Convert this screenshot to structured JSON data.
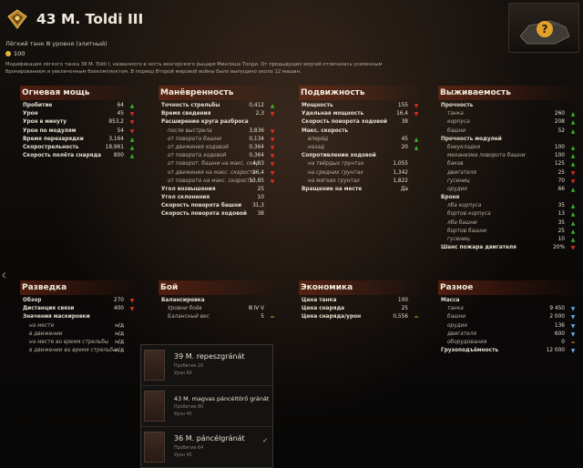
{
  "header": {
    "title": "43 M. Toldi III",
    "subtitle": "Лёгкий танк Ⅲ уровня (элитный)",
    "price": "100",
    "description": "Модификация лёгкого танка 38 M. Toldi I, названного в честь венгерского рыцаря Миклоша Толди. От предыдущих версий отличалась усиленным бронированием и увеличенным боекомплектом. В период Второй мировой войны было выпущено около 12 машин."
  },
  "colors": {
    "up": "#38b02a",
    "down": "#d63020",
    "equal": "#e1a02a",
    "blue": "#6aa2e0",
    "coin": "#e2b43a"
  },
  "panels": {
    "firepower": {
      "title": "Огневая мощь",
      "rows": [
        {
          "label": "Пробитие",
          "value": "64",
          "ind": "up",
          "cls": "up"
        },
        {
          "label": "Урон",
          "value": "45",
          "ind": "down",
          "cls": "down"
        },
        {
          "label": "Урон в минуту",
          "value": "853,2",
          "ind": "down",
          "cls": "down"
        },
        {
          "label": "Урон по модулям",
          "value": "54",
          "ind": "down",
          "cls": "down"
        },
        {
          "label": "Время перезарядки",
          "value": "3,164",
          "ind": "up",
          "cls": "up"
        },
        {
          "label": "Скорострельность",
          "value": "18,961",
          "ind": "up",
          "cls": "up"
        },
        {
          "label": "Скорость полёта снаряда",
          "value": "800",
          "ind": "up",
          "cls": "up"
        }
      ]
    },
    "maneuver": {
      "title": "Манёвренность",
      "rows": [
        {
          "label": "Точность стрельбы",
          "value": "0,412",
          "ind": "up",
          "cls": "up"
        },
        {
          "label": "Время сведения",
          "value": "2,3",
          "ind": "down",
          "cls": "down"
        },
        {
          "label": "Расширение круга разброса",
          "value": "",
          "ind": "",
          "cls": ""
        },
        {
          "label": "после выстрела",
          "value": "3,836",
          "ind": "down",
          "cls": "down",
          "sub": true
        },
        {
          "label": "от поворота башни",
          "value": "0,134",
          "ind": "down",
          "cls": "down",
          "sub": true
        },
        {
          "label": "от движения ходовой",
          "value": "0,364",
          "ind": "down",
          "cls": "down",
          "sub": true
        },
        {
          "label": "от поворота ходовой",
          "value": "0,364",
          "ind": "down",
          "cls": "down",
          "sub": true
        },
        {
          "label": "от поворот. башни на макс. скор.",
          "value": "4,03",
          "ind": "down",
          "cls": "down",
          "sub": true
        },
        {
          "label": "от движения на макс. скорости",
          "value": "16,4",
          "ind": "down",
          "cls": "down",
          "sub": true
        },
        {
          "label": "от поворота на макс. скорости",
          "value": "13,85",
          "ind": "down",
          "cls": "down",
          "sub": true
        },
        {
          "label": "Угол возвышения",
          "value": "25",
          "ind": "",
          "cls": ""
        },
        {
          "label": "Угол склонения",
          "value": "10",
          "ind": "",
          "cls": ""
        },
        {
          "label": "Скорость поворота башни",
          "value": "31,3",
          "ind": "",
          "cls": ""
        },
        {
          "label": "Скорость поворота ходовой",
          "value": "38",
          "ind": "",
          "cls": ""
        }
      ]
    },
    "mobility": {
      "title": "Подвижность",
      "rows": [
        {
          "label": "Мощность",
          "value": "155",
          "ind": "down",
          "cls": "down"
        },
        {
          "label": "Удельная мощность",
          "value": "16,4",
          "ind": "down",
          "cls": "down"
        },
        {
          "label": "Скорость поворота ходовой",
          "value": "38",
          "ind": "",
          "cls": ""
        },
        {
          "label": "Макс. скорость",
          "value": "",
          "ind": "",
          "cls": ""
        },
        {
          "label": "вперёд",
          "value": "45",
          "ind": "up",
          "cls": "up",
          "sub": true
        },
        {
          "label": "назад",
          "value": "20",
          "ind": "up",
          "cls": "up",
          "sub": true
        },
        {
          "label": "Сопротивление ходовой",
          "value": "",
          "ind": "",
          "cls": ""
        },
        {
          "label": "на твёрдых грунтах",
          "value": "1,055",
          "ind": "",
          "cls": "",
          "sub": true
        },
        {
          "label": "на средних грунтах",
          "value": "1,342",
          "ind": "",
          "cls": "",
          "sub": true
        },
        {
          "label": "на мягких грунтах",
          "value": "1,822",
          "ind": "",
          "cls": "",
          "sub": true
        },
        {
          "label": "Вращение на месте",
          "value": "Да",
          "ind": "",
          "cls": ""
        }
      ]
    },
    "survivability": {
      "title": "Выживаемость",
      "rows": [
        {
          "label": "Прочность",
          "value": "",
          "ind": "",
          "cls": ""
        },
        {
          "label": "танка",
          "value": "260",
          "ind": "up",
          "cls": "up",
          "sub": true
        },
        {
          "label": "корпуса",
          "value": "208",
          "ind": "up",
          "cls": "up",
          "sub": true
        },
        {
          "label": "башни",
          "value": "52",
          "ind": "up",
          "cls": "up",
          "sub": true
        },
        {
          "label": "Прочность модулей",
          "value": "",
          "ind": "",
          "cls": ""
        },
        {
          "label": "боеукладки",
          "value": "100",
          "ind": "up",
          "cls": "up",
          "sub": true
        },
        {
          "label": "механизма поворота башни",
          "value": "100",
          "ind": "up",
          "cls": "up",
          "sub": true
        },
        {
          "label": "баков",
          "value": "125",
          "ind": "up",
          "cls": "up",
          "sub": true
        },
        {
          "label": "двигателя",
          "value": "25",
          "ind": "down",
          "cls": "down",
          "sub": true
        },
        {
          "label": "гусениц",
          "value": "70",
          "ind": "down",
          "cls": "down",
          "sub": true
        },
        {
          "label": "орудия",
          "value": "66",
          "ind": "up",
          "cls": "up",
          "sub": true
        },
        {
          "label": "Броня",
          "value": "",
          "ind": "",
          "cls": ""
        },
        {
          "label": "лба корпуса",
          "value": "35",
          "ind": "up",
          "cls": "up",
          "sub": true
        },
        {
          "label": "бортов корпуса",
          "value": "13",
          "ind": "up",
          "cls": "up",
          "sub": true
        },
        {
          "label": "лба башни",
          "value": "35",
          "ind": "up",
          "cls": "up",
          "sub": true
        },
        {
          "label": "бортов башни",
          "value": "25",
          "ind": "up",
          "cls": "up",
          "sub": true
        },
        {
          "label": "гусениц",
          "value": "10",
          "ind": "up",
          "cls": "up",
          "sub": true
        },
        {
          "label": "Шанс пожара двигателя",
          "value": "20%",
          "ind": "down",
          "cls": "down"
        }
      ]
    },
    "recon": {
      "title": "Разведка",
      "rows": [
        {
          "label": "Обзор",
          "value": "270",
          "ind": "down",
          "cls": "down"
        },
        {
          "label": "Дистанция связи",
          "value": "400",
          "ind": "down",
          "cls": "down"
        },
        {
          "label": "Значения маскировки",
          "value": "",
          "ind": "",
          "cls": ""
        },
        {
          "label": "на месте",
          "value": "н/д",
          "ind": "",
          "cls": "",
          "sub": true
        },
        {
          "label": "в движении",
          "value": "н/д",
          "ind": "",
          "cls": "",
          "sub": true
        },
        {
          "label": "на месте во время стрельбы",
          "value": "н/д",
          "ind": "",
          "cls": "",
          "sub": true
        },
        {
          "label": "в движении во время стрельбы",
          "value": "н/д",
          "ind": "",
          "cls": "",
          "sub": true
        }
      ]
    },
    "battle": {
      "title": "Бой",
      "rows": [
        {
          "label": "Балансировка",
          "value": "",
          "ind": "",
          "cls": ""
        },
        {
          "label": "Уровни боёв",
          "value": "Ⅲ Ⅳ V",
          "ind": "",
          "cls": "",
          "sub": true
        },
        {
          "label": "Балансный вес",
          "value": "5",
          "ind": "eq",
          "cls": "eq",
          "sub": true
        }
      ]
    },
    "economy": {
      "title": "Экономика",
      "rows": [
        {
          "label": "Цена танка",
          "value": "100",
          "ind": "",
          "cls": ""
        },
        {
          "label": "Цена снаряда",
          "value": "25",
          "ind": "",
          "cls": ""
        },
        {
          "label": "Цена снаряда/урон",
          "value": "0,556",
          "ind": "eq",
          "cls": "eq"
        }
      ]
    },
    "misc": {
      "title": "Разное",
      "rows": [
        {
          "label": "Масса",
          "value": "",
          "ind": "",
          "cls": ""
        },
        {
          "label": "танка",
          "value": "9 450",
          "ind": "blue",
          "cls": "blue",
          "sub": true
        },
        {
          "label": "башни",
          "value": "2 000",
          "ind": "blue",
          "cls": "blue",
          "sub": true
        },
        {
          "label": "орудия",
          "value": "136",
          "ind": "blue",
          "cls": "blue",
          "sub": true
        },
        {
          "label": "двигателя",
          "value": "600",
          "ind": "blue",
          "cls": "blue",
          "sub": true
        },
        {
          "label": "оборудования",
          "value": "0",
          "ind": "eq",
          "cls": "eq",
          "sub": true
        },
        {
          "label": "Грузоподъёмность",
          "value": "12 000",
          "ind": "blue",
          "cls": "blue"
        }
      ]
    }
  },
  "ammo": [
    {
      "name": "39 M. repeszgránát",
      "pen": "Пробитие 20",
      "dmg": "Урон 60",
      "selected": ""
    },
    {
      "name": "43 M. magvas páncéltörő gránát",
      "pen": "Пробитие 80",
      "dmg": "Урон 45",
      "selected": ""
    },
    {
      "name": "36 M. páncélgránát",
      "pen": "Пробитие 64",
      "dmg": "Урон 45",
      "selected": "✓"
    }
  ]
}
